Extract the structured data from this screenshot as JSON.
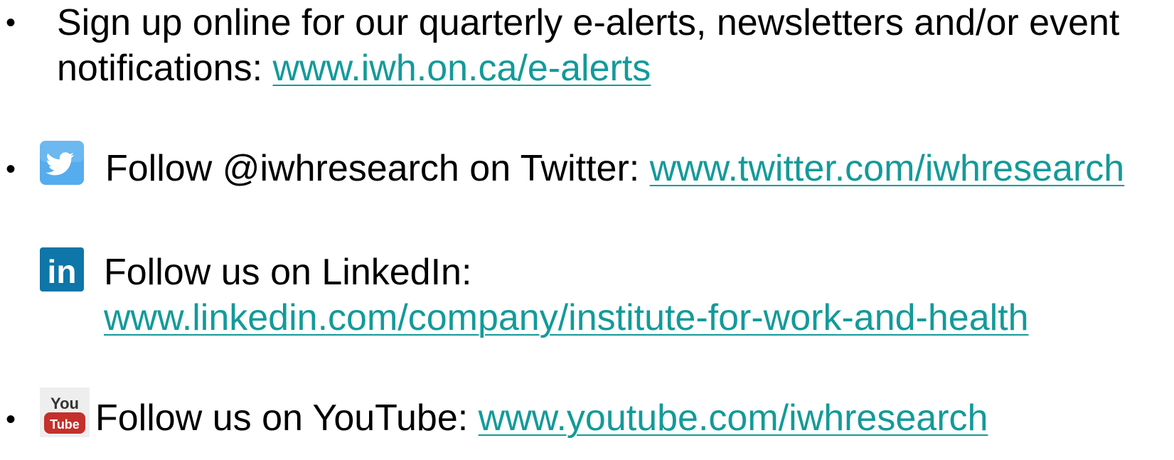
{
  "colors": {
    "link": "#139a9a",
    "text": "#000000",
    "twitter_icon_bg": "#55acee",
    "linkedin_icon_bg": "#0e76a8",
    "youtube_icon_red": "#c4302b"
  },
  "bullet_char": "•",
  "items": [
    {
      "line1": "Sign up online for our quarterly e-alerts, newsletters and/or event",
      "line2_prefix": "notifications: ",
      "link": "www.iwh.on.ca/e-alerts"
    },
    {
      "icon": "twitter-icon",
      "text": "Follow @iwhresearch on Twitter: ",
      "link": "www.twitter.com/iwhresearch"
    },
    {
      "icon": "linkedin-icon",
      "icon_text": "in",
      "text": "Follow us on LinkedIn:",
      "link": "www.linkedin.com/company/institute-for-work-and-health"
    },
    {
      "icon": "youtube-icon",
      "icon_text_top": "You",
      "icon_text_bottom": "Tube",
      "text": "Follow us on YouTube: ",
      "link": "www.youtube.com/iwhresearch"
    }
  ]
}
